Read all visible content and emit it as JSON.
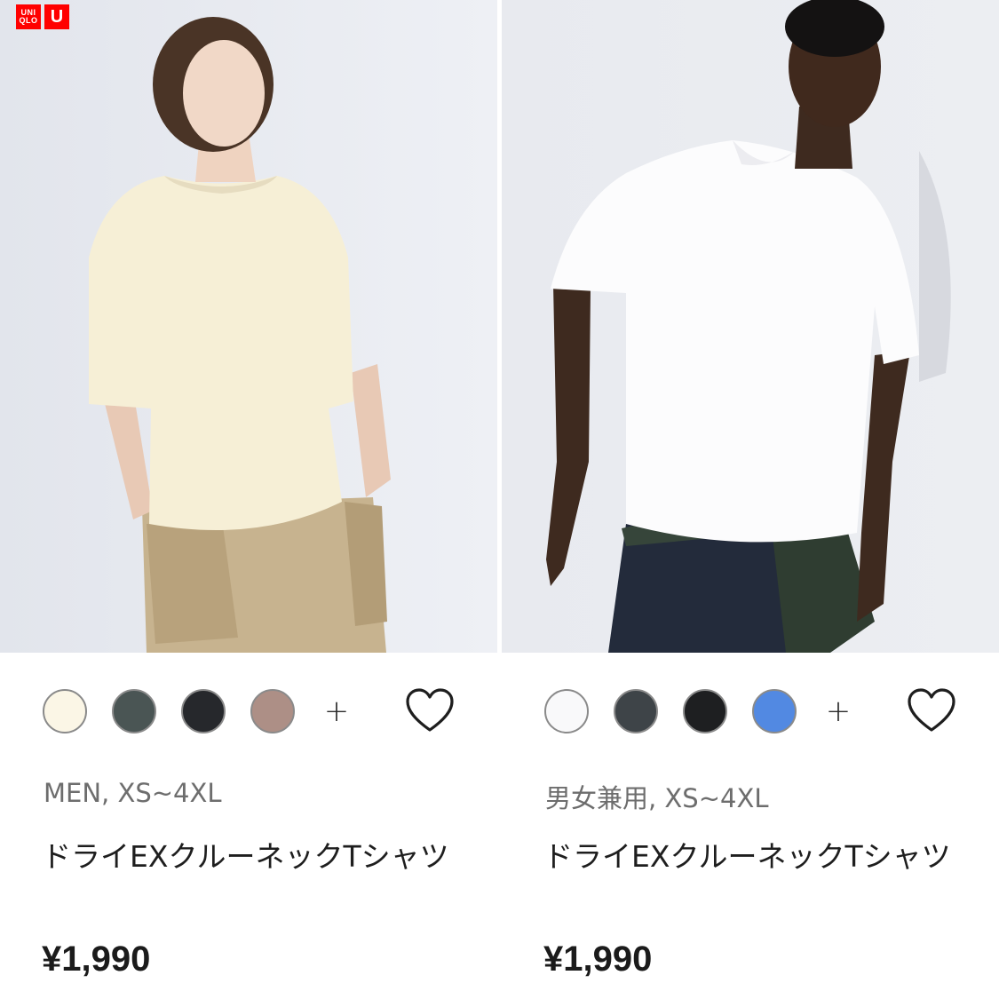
{
  "brand": {
    "logo_uniqlo_top": "UNI",
    "logo_uniqlo_bottom": "QLO",
    "logo_u": "U",
    "accent": "#ff0000"
  },
  "products": [
    {
      "swatches": [
        "#fbf6e6",
        "#4a5554",
        "#26282c",
        "#ad8f86"
      ],
      "more_label": "+",
      "favorite_icon": "heart-outline-icon",
      "meta": "MEN, XS~4XL",
      "name": "ドライEXクルーネックTシャツ",
      "price": "¥1,990"
    },
    {
      "swatches": [
        "#f9f9fa",
        "#3e4448",
        "#1e1f21",
        "#5289e2"
      ],
      "more_label": "+",
      "favorite_icon": "heart-outline-icon",
      "meta": "男女兼用, XS~4XL",
      "name": "ドライEXクルーネックTシャツ",
      "price": "¥1,990"
    }
  ]
}
